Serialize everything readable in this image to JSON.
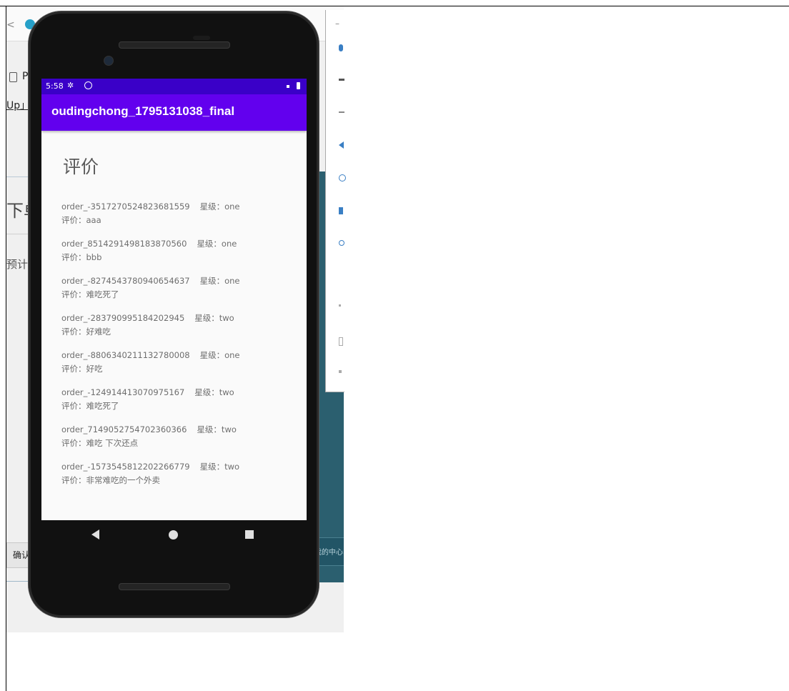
{
  "background": {
    "device_label": "P",
    "up_label": "Up」",
    "order_label": "下单",
    "estimate_label": "预计",
    "confirm_label": "确认",
    "teal_text": "我的中心"
  },
  "statusbar": {
    "time": "5:58"
  },
  "appbar": {
    "title": "oudingchong_1795131038_final"
  },
  "page": {
    "heading": "评价"
  },
  "reviews": [
    {
      "order": "order_-3517270524823681559",
      "stars": "星级：one",
      "comment": "评价：aaa"
    },
    {
      "order": "order_8514291498183870560",
      "stars": "星级：one",
      "comment": "评价：bbb"
    },
    {
      "order": "order_-8274543780940654637",
      "stars": "星级：one",
      "comment": "评价：难吃死了"
    },
    {
      "order": "order_-283790995184202945",
      "stars": "星级：two",
      "comment": "评价：好难吃"
    },
    {
      "order": "order_-8806340211132780008",
      "stars": "星级：one",
      "comment": "评价：好吃"
    },
    {
      "order": "order_-124914413070975167",
      "stars": "星级：two",
      "comment": "评价：难吃死了"
    },
    {
      "order": "order_7149052754702360366",
      "stars": "星级：two",
      "comment": "评价：难吃 下次还点"
    },
    {
      "order": "order_-1573545812202266779",
      "stars": "星级：two",
      "comment": "评价：非常难吃的一个外卖"
    }
  ],
  "colors": {
    "statusbar": "#3a00c8",
    "appbar": "#6200ee",
    "screen_bg": "#fafafa"
  }
}
